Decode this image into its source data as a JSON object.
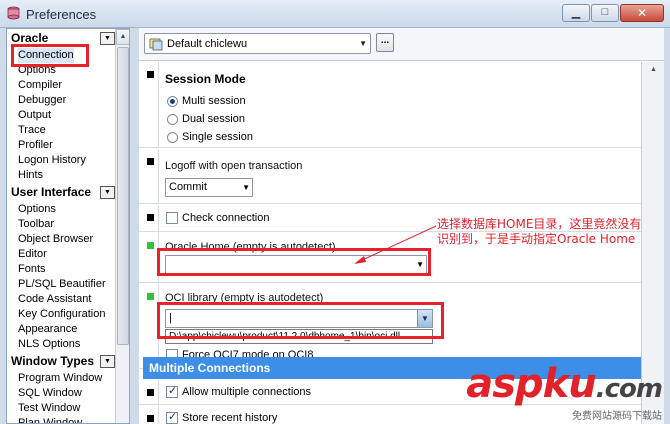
{
  "window": {
    "title": "Preferences"
  },
  "nav": {
    "groups": [
      {
        "label": "Oracle",
        "items": [
          "Connection",
          "Options",
          "Compiler",
          "Debugger",
          "Output",
          "Trace",
          "Profiler",
          "Logon History",
          "Hints"
        ]
      },
      {
        "label": "User Interface",
        "items": [
          "Options",
          "Toolbar",
          "Object Browser",
          "Editor",
          "Fonts",
          "PL/SQL Beautifier",
          "Code Assistant",
          "Key Configuration",
          "Appearance",
          "NLS Options"
        ]
      },
      {
        "label": "Window Types",
        "items": [
          "Program Window",
          "SQL Window",
          "Test Window",
          "Plan Window"
        ]
      }
    ],
    "selected": "Connection"
  },
  "toolbar": {
    "profile": "Default chiclewu",
    "more_label": "..."
  },
  "session_mode": {
    "title": "Session Mode",
    "options": [
      "Multi session",
      "Dual session",
      "Single session"
    ],
    "selected_index": 0
  },
  "logoff": {
    "label": "Logoff with open transaction",
    "value": "Commit"
  },
  "check_connection": {
    "label": "Check connection",
    "checked": false
  },
  "oracle_home": {
    "label": "Oracle Home (empty is autodetect)",
    "value": ""
  },
  "oci_library": {
    "label": "OCI library (empty is autodetect)",
    "value": "|",
    "dropdown_option": "D:\\app\\chiclewu\\product\\11.2.0\\dbhome_1\\bin\\oci.dll"
  },
  "force_oci7": {
    "label": "Force OCI7 mode on OCI8"
  },
  "multiple_connections": {
    "title": "Multiple Connections",
    "allow": {
      "label": "Allow multiple connections",
      "checked": true
    },
    "store": {
      "label": "Store recent history",
      "checked": true
    }
  },
  "annotation": {
    "line1": "选择数据库HOME目录，这里竟然没有",
    "line2": "识别到，于是手动指定Oracle Home"
  },
  "watermark": {
    "logo_a": "asp",
    "logo_b": "ku",
    "logo_c": ".com",
    "subtitle": "免费网站源码下载站"
  },
  "colors": {
    "accent_band": "#3d8ee8",
    "annotation_red": "#e3212a",
    "marker_green": "#2fc23a"
  }
}
